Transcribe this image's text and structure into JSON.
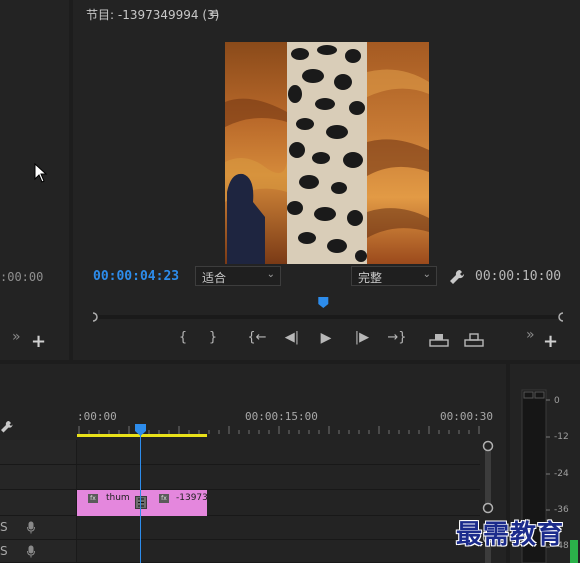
{
  "left_panel": {
    "timecode": ":00:00",
    "expand_glyph": "»",
    "add_glyph": "+"
  },
  "program_monitor": {
    "title": "节目: -1397349994 (3)",
    "menu_glyph": "≡",
    "current_time": "00:00:04:23",
    "zoom": {
      "selected": "适合"
    },
    "quality": {
      "selected": "完整"
    },
    "duration": "00:00:10:00",
    "playhead_fraction": 0.49,
    "transport": {
      "mark_in": "{",
      "mark_out": "}",
      "go_to_in": "{←",
      "step_back": "◀|",
      "play": "▶",
      "step_forward": "|▶",
      "go_to_out": "→}",
      "expand_glyph": "»",
      "add_glyph": "+"
    }
  },
  "timeline": {
    "ruler_labels": [
      ":00:00",
      "00:00:15:00",
      "00:00:30"
    ],
    "track_labels": [
      "S",
      "S"
    ],
    "clip": {
      "name": "thum",
      "name2": "-13973",
      "fx_label": "fx",
      "color": "#e487dd"
    },
    "playhead_color": "#2d8ceb",
    "work_area_color": "#e8e019"
  },
  "audio_meter": {
    "ticks": [
      "0",
      "-12",
      "-24",
      "-36",
      "-48"
    ]
  },
  "watermark": "最需教育"
}
